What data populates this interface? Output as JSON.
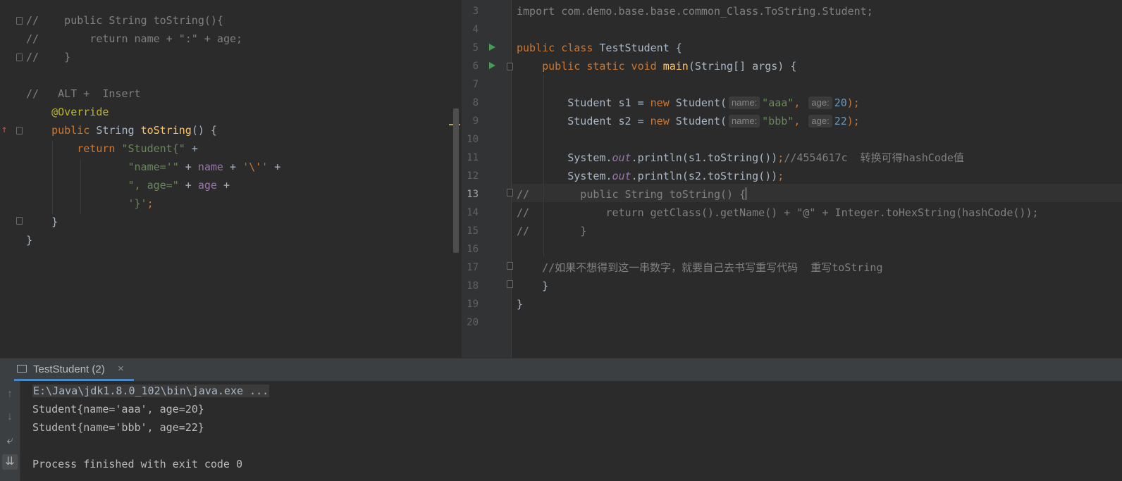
{
  "left_editor": {
    "lines": [
      {
        "parts": [
          {
            "t": "//    public String toString(){",
            "c": "cm"
          }
        ]
      },
      {
        "parts": [
          {
            "t": "//        return name + \":\" + age;",
            "c": "cm"
          }
        ]
      },
      {
        "parts": [
          {
            "t": "//    }",
            "c": "cm"
          }
        ]
      },
      {
        "parts": []
      },
      {
        "parts": [
          {
            "t": "//   ALT +  Insert",
            "c": "cm"
          }
        ]
      },
      {
        "parts": [
          {
            "t": "    ",
            "c": "pl"
          },
          {
            "t": "@Override",
            "c": "ann"
          }
        ]
      },
      {
        "parts": [
          {
            "t": "    ",
            "c": "pl"
          },
          {
            "t": "public ",
            "c": "kw"
          },
          {
            "t": "String ",
            "c": "pl"
          },
          {
            "t": "toString",
            "c": "fn"
          },
          {
            "t": "() {",
            "c": "pl"
          }
        ]
      },
      {
        "parts": [
          {
            "t": "        ",
            "c": "pl"
          },
          {
            "t": "return ",
            "c": "kw"
          },
          {
            "t": "\"Student{\" ",
            "c": "str"
          },
          {
            "t": "+",
            "c": "pl"
          }
        ]
      },
      {
        "parts": [
          {
            "t": "                ",
            "c": "pl"
          },
          {
            "t": "\"name='\" ",
            "c": "str"
          },
          {
            "t": "+ ",
            "c": "pl"
          },
          {
            "t": "name ",
            "c": "fld"
          },
          {
            "t": "+ ",
            "c": "pl"
          },
          {
            "t": "'",
            "c": "str"
          },
          {
            "t": "\\'",
            "c": "esc"
          },
          {
            "t": "' ",
            "c": "str"
          },
          {
            "t": "+",
            "c": "pl"
          }
        ]
      },
      {
        "parts": [
          {
            "t": "                ",
            "c": "pl"
          },
          {
            "t": "\", age=\" ",
            "c": "str"
          },
          {
            "t": "+ ",
            "c": "pl"
          },
          {
            "t": "age ",
            "c": "fld"
          },
          {
            "t": "+",
            "c": "pl"
          }
        ]
      },
      {
        "parts": [
          {
            "t": "                ",
            "c": "pl"
          },
          {
            "t": "'}'",
            "c": "str"
          },
          {
            "t": ";",
            "c": "kw"
          }
        ]
      },
      {
        "parts": [
          {
            "t": "    }",
            "c": "pl"
          }
        ]
      },
      {
        "parts": [
          {
            "t": "}",
            "c": "pl"
          }
        ]
      }
    ]
  },
  "right_editor": {
    "line_numbers": [
      "3",
      "4",
      "5",
      "6",
      "7",
      "8",
      "9",
      "10",
      "11",
      "12",
      "13",
      "14",
      "15",
      "16",
      "17",
      "18",
      "19",
      "20"
    ],
    "lines": [
      {
        "parts": [
          {
            "t": "import com.demo.base.base.common_Class.ToString.Student;",
            "c": "cm"
          }
        ]
      },
      {
        "parts": []
      },
      {
        "parts": [
          {
            "t": "public class ",
            "c": "kw"
          },
          {
            "t": "TestStudent {",
            "c": "pl"
          }
        ]
      },
      {
        "parts": [
          {
            "t": "    ",
            "c": "pl"
          },
          {
            "t": "public static void ",
            "c": "kw"
          },
          {
            "t": "main",
            "c": "fn"
          },
          {
            "t": "(String[] args) {",
            "c": "pl"
          }
        ]
      },
      {
        "parts": []
      },
      {
        "parts": [
          {
            "t": "        Student s1 = ",
            "c": "pl"
          },
          {
            "t": "new ",
            "c": "kw"
          },
          {
            "t": "Student(",
            "c": "pl"
          },
          {
            "h": "name:"
          },
          {
            "t": "\"aaa\"",
            "c": "str"
          },
          {
            "t": ", ",
            "c": "kw"
          },
          {
            "h": "age:"
          },
          {
            "t": "20",
            "c": "num"
          },
          {
            "t": ");",
            "c": "kw"
          }
        ]
      },
      {
        "parts": [
          {
            "t": "        Student s2 = ",
            "c": "pl"
          },
          {
            "t": "new ",
            "c": "kw"
          },
          {
            "t": "Student(",
            "c": "pl"
          },
          {
            "h": "name:"
          },
          {
            "t": "\"bbb\"",
            "c": "str"
          },
          {
            "t": ", ",
            "c": "kw"
          },
          {
            "h": "age:"
          },
          {
            "t": "22",
            "c": "num"
          },
          {
            "t": ");",
            "c": "kw"
          }
        ]
      },
      {
        "parts": []
      },
      {
        "parts": [
          {
            "t": "        System.",
            "c": "pl"
          },
          {
            "t": "out",
            "c": "st"
          },
          {
            "t": ".println(s1.toString())",
            "c": "pl"
          },
          {
            "t": ";",
            "c": "kw"
          },
          {
            "t": "//4554617c  转换可得hashCode值",
            "c": "cm"
          }
        ]
      },
      {
        "parts": [
          {
            "t": "        System.",
            "c": "pl"
          },
          {
            "t": "out",
            "c": "st"
          },
          {
            "t": ".println(s2.toString())",
            "c": "pl"
          },
          {
            "t": ";",
            "c": "kw"
          }
        ]
      },
      {
        "parts": [
          {
            "t": "//        public String toString() {",
            "c": "cm"
          },
          {
            "caret": true
          }
        ]
      },
      {
        "parts": [
          {
            "t": "//            return getClass().getName() + \"@\" + Integer.toHexString(hashCode());",
            "c": "cm"
          }
        ]
      },
      {
        "parts": [
          {
            "t": "//        }",
            "c": "cm"
          }
        ]
      },
      {
        "parts": []
      },
      {
        "parts": [
          {
            "t": "    //如果不想得到这一串数字，就要自己去书写重写代码  重写toString",
            "c": "cm"
          }
        ]
      },
      {
        "parts": [
          {
            "t": "    }",
            "c": "pl"
          }
        ]
      },
      {
        "parts": [
          {
            "t": "}",
            "c": "pl"
          }
        ]
      },
      {
        "parts": []
      }
    ]
  },
  "run_panel": {
    "tab_label": "TestStudent (2)",
    "close_glyph": "×",
    "console_lines": [
      "E:\\Java\\jdk1.8.0_102\\bin\\java.exe ...",
      "Student{name='aaa', age=20}",
      "Student{name='bbb', age=22}",
      "",
      "Process finished with exit code 0"
    ]
  },
  "icons": {
    "up": "↑",
    "down": "↓",
    "wrap": "⤶",
    "scroll_end": "⇊"
  }
}
